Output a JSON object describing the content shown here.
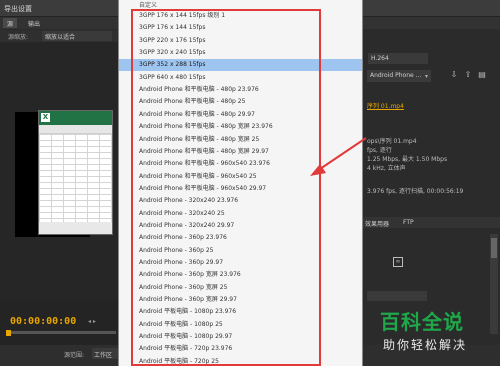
{
  "window": {
    "title": "导出设置",
    "tabs": [
      "源",
      "输出"
    ]
  },
  "source": {
    "label": "源缩放:",
    "value": "缩放以适合"
  },
  "preview": {
    "timecode": "00:00:00:00"
  },
  "range": {
    "label": "源范围:",
    "value": "工作区"
  },
  "dropdown": {
    "top_label": "自定义",
    "items": [
      "3GPP 176 x 144 15fps 级别 1",
      "3GPP 176 x 144 15fps",
      "3GPP 220 x 176 15fps",
      "3GPP 320 x 240 15fps",
      "3GPP 352 x 288 15fps",
      "3GPP 640 x 480 15fps",
      "Android Phone 和平板电脑 - 480p 23.976",
      "Android Phone 和平板电脑 - 480p 25",
      "Android Phone 和平板电脑 - 480p 29.97",
      "Android Phone 和平板电脑 - 480p 宽屏 23.976",
      "Android Phone 和平板电脑 - 480p 宽屏 25",
      "Android Phone 和平板电脑 - 480p 宽屏 29.97",
      "Android Phone 和平板电脑 - 960x540 23.976",
      "Android Phone 和平板电脑 - 960x540 25",
      "Android Phone 和平板电脑 - 960x540 29.97",
      "Android Phone - 320x240 23.976",
      "Android Phone - 320x240 25",
      "Android Phone - 320x240 29.97",
      "Android Phone - 360p 23.976",
      "Android Phone - 360p 25",
      "Android Phone - 360p 29.97",
      "Android Phone - 360p 宽屏 23.976",
      "Android Phone - 360p 宽屏 25",
      "Android Phone - 360p 宽屏 29.97",
      "Android 平板电脑 - 1080p 23.976",
      "Android 平板电脑 - 1080p 25",
      "Android 平板电脑 - 1080p 29.97",
      "Android 平板电脑 - 720p 23.976",
      "Android 平板电脑 - 720p 25"
    ],
    "selected": "3GPP 352 x 288 15fps"
  },
  "right_panel": {
    "format": "H.264",
    "preset": "Android Phone ...",
    "output_name": "序列 01.mp4",
    "summary_lines": [
      "ops\\序列 01.mp4",
      "fps, 逐行",
      "1.25 Mbps, 最大 1.50 Mbps",
      "4 kHz, 立体声"
    ],
    "summary2": "3.976 fps, 逐行扫描, 00:00:56:19",
    "tab_left": "效果用器",
    "tab_right": "FTP"
  },
  "watermark": {
    "logo_text": "百科全说",
    "sub_text": "助你轻松解决"
  },
  "colors": {
    "highlight": "#e03a3a",
    "selected_row": "#9ec5ef",
    "timecode": "#e8a500",
    "excel_green": "#217346"
  }
}
